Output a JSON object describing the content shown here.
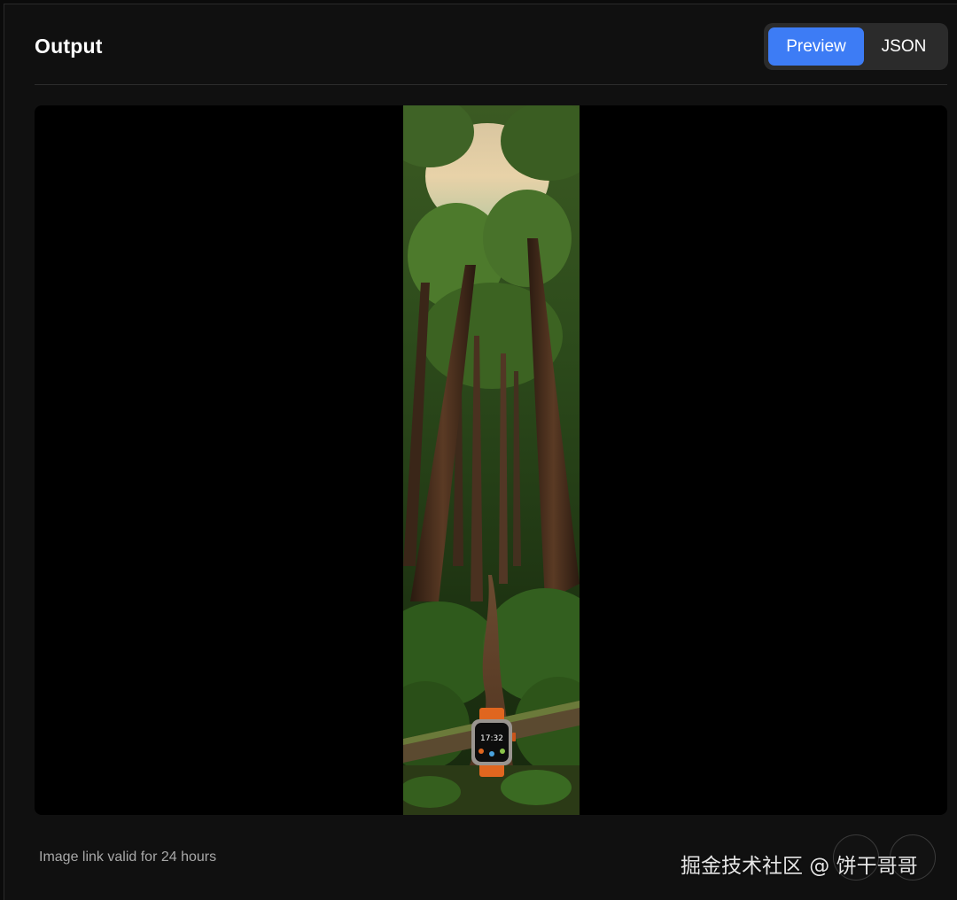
{
  "header": {
    "title": "Output"
  },
  "view_toggle": {
    "options": [
      {
        "label": "Preview",
        "active": true
      },
      {
        "label": "JSON",
        "active": false
      }
    ],
    "accent_color": "#3d7cf5"
  },
  "footer": {
    "note": "Image link valid for 24 hours",
    "action_icons": [
      "download-icon",
      "share-icon"
    ]
  },
  "watermark": {
    "text": "掘金技术社区 @ 饼干哥哥"
  },
  "watch_face": {
    "time": "17:32"
  }
}
